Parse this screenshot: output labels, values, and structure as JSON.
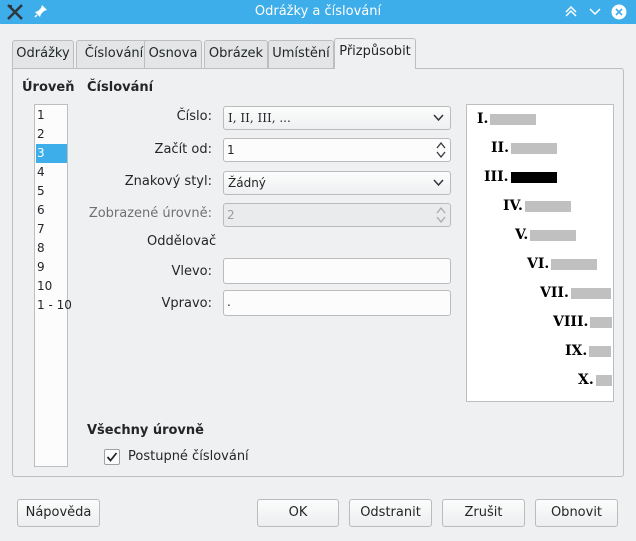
{
  "window": {
    "title": "Odrážky a číslování"
  },
  "tabs": [
    {
      "label": "Odrážky"
    },
    {
      "label": "Číslování"
    },
    {
      "label": "Osnova"
    },
    {
      "label": "Obrázek"
    },
    {
      "label": "Umístění"
    },
    {
      "label": "Přizpůsobit",
      "active": true
    }
  ],
  "level": {
    "heading": "Úroveň",
    "items": [
      "1",
      "2",
      "3",
      "4",
      "5",
      "6",
      "7",
      "8",
      "9",
      "10",
      "1 - 10"
    ],
    "selected": "3"
  },
  "numbering": {
    "heading": "Číslování",
    "number_label": "Číslo:",
    "number_value": "I, II, III, ...",
    "start_label": "Začít od:",
    "start_value": "1",
    "char_style_label": "Znakový styl:",
    "char_style_value": "Žádný",
    "shown_levels_label": "Zobrazené úrovně:",
    "shown_levels_value": "2",
    "separator_heading": "Oddělovač",
    "before_label": "Vlevo:",
    "before_value": "",
    "after_label": "Vpravo:",
    "after_value": "."
  },
  "preview": {
    "rows": [
      {
        "num": "I.",
        "active": false
      },
      {
        "num": "II.",
        "active": false
      },
      {
        "num": "III.",
        "active": true
      },
      {
        "num": "IV.",
        "active": false
      },
      {
        "num": "V.",
        "active": false
      },
      {
        "num": "VI.",
        "active": false
      },
      {
        "num": "VII.",
        "active": false
      },
      {
        "num": "VIII.",
        "active": false
      },
      {
        "num": "IX.",
        "active": false
      },
      {
        "num": "X.",
        "active": false
      }
    ]
  },
  "all_levels": {
    "heading": "Všechny úrovně",
    "consecutive_label": "Postupné číslování",
    "consecutive_checked": true
  },
  "buttons": {
    "help": "Nápověda",
    "ok": "OK",
    "remove": "Odstranit",
    "cancel": "Zrušit",
    "reset": "Obnovit"
  },
  "colors": {
    "titlebar": "#3daee9",
    "selection": "#3daee9"
  }
}
